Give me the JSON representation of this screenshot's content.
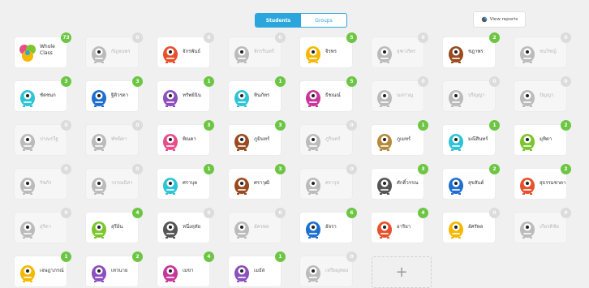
{
  "tabs": [
    {
      "label": "Students"
    },
    {
      "label": "Groups"
    }
  ],
  "view_reports_label": "View reports",
  "colors": {
    "accent": "#2aa6dd",
    "point_badge": "#6cc644",
    "zero_badge": "#dcdcdc"
  },
  "add_label": "+",
  "cards": [
    {
      "name": "Whole Class",
      "points": "73",
      "avatar": "class-icon",
      "color": "#e84c8a",
      "dim": false
    },
    {
      "name": "กัญจนพร",
      "points": "0",
      "avatar": "monster-avatar",
      "color": "#bbbbbb",
      "dim": true
    },
    {
      "name": "จักรพันธ์",
      "points": "0",
      "avatar": "monster-avatar",
      "color": "#e8502b",
      "dim": false
    },
    {
      "name": "จักรรินทร์",
      "points": "0",
      "avatar": "monster-avatar",
      "color": "#bbbbbb",
      "dim": true
    },
    {
      "name": "จิรพร",
      "points": "5",
      "avatar": "monster-avatar",
      "color": "#f5b800",
      "dim": false
    },
    {
      "name": "จุฑาภัทร",
      "points": "0",
      "avatar": "monster-avatar",
      "color": "#bbbbbb",
      "dim": true
    },
    {
      "name": "ชฎาพร",
      "points": "2",
      "avatar": "monster-avatar",
      "color": "#9a4a1e",
      "dim": false
    },
    {
      "name": "ชนวิชญ์",
      "points": "0",
      "avatar": "monster-avatar",
      "color": "#bbbbbb",
      "dim": true
    },
    {
      "name": "ชัดชนก",
      "points": "3",
      "avatar": "monster-avatar",
      "color": "#2ec3d6",
      "dim": false
    },
    {
      "name": "ฐิติวรดา",
      "points": "3",
      "avatar": "monster-avatar",
      "color": "#1e6fd0",
      "dim": false
    },
    {
      "name": "ทรัพย์นิน",
      "points": "1",
      "avatar": "monster-avatar",
      "color": "#8b4fc0",
      "dim": false
    },
    {
      "name": "ทินภัทร",
      "points": "1",
      "avatar": "monster-avatar",
      "color": "#2ec3d6",
      "dim": false
    },
    {
      "name": "ธิชณณ์",
      "points": "5",
      "avatar": "monster-avatar",
      "color": "#c7369a",
      "dim": false
    },
    {
      "name": "นภกาญ",
      "points": "0",
      "avatar": "monster-avatar",
      "color": "#bbbbbb",
      "dim": true
    },
    {
      "name": "ปริญญา",
      "points": "0",
      "avatar": "monster-avatar",
      "color": "#bbbbbb",
      "dim": true
    },
    {
      "name": "ปัญญา",
      "points": "0",
      "avatar": "monster-avatar",
      "color": "#bbbbbb",
      "dim": true
    },
    {
      "name": "ปาณรวีฐ",
      "points": "0",
      "avatar": "monster-avatar",
      "color": "#bbbbbb",
      "dim": true
    },
    {
      "name": "พัชนิดา",
      "points": "0",
      "avatar": "monster-avatar",
      "color": "#bbbbbb",
      "dim": true
    },
    {
      "name": "พิณดา",
      "points": "3",
      "avatar": "monster-avatar",
      "color": "#e84c8a",
      "dim": false
    },
    {
      "name": "ภูมินทร์",
      "points": "3",
      "avatar": "monster-avatar",
      "color": "#9a4a1e",
      "dim": false
    },
    {
      "name": "ภูรินทร์",
      "points": "0",
      "avatar": "monster-avatar",
      "color": "#bbbbbb",
      "dim": true
    },
    {
      "name": "ภูเมทร์",
      "points": "1",
      "avatar": "monster-avatar",
      "color": "#b58a3c",
      "dim": false
    },
    {
      "name": "มณีสินทร์",
      "points": "1",
      "avatar": "monster-avatar",
      "color": "#2ec3d6",
      "dim": false
    },
    {
      "name": "มุทิตา",
      "points": "2",
      "avatar": "monster-avatar",
      "color": "#7bc62d",
      "dim": false
    },
    {
      "name": "รัชภัร",
      "points": "0",
      "avatar": "monster-avatar",
      "color": "#bbbbbb",
      "dim": true
    },
    {
      "name": "วรรณนิสา",
      "points": "0",
      "avatar": "monster-avatar",
      "color": "#bbbbbb",
      "dim": true
    },
    {
      "name": "ศราบุต",
      "points": "1",
      "avatar": "monster-avatar",
      "color": "#2ec3d6",
      "dim": false
    },
    {
      "name": "ศราวุฒิ",
      "points": "3",
      "avatar": "monster-avatar",
      "color": "#9a4a1e",
      "dim": false
    },
    {
      "name": "ศรารุส",
      "points": "0",
      "avatar": "monster-avatar",
      "color": "#bbbbbb",
      "dim": true
    },
    {
      "name": "ศักดิ์วรรณ",
      "points": "3",
      "avatar": "monster-avatar",
      "color": "#555555",
      "dim": false
    },
    {
      "name": "สุขสันต์",
      "points": "2",
      "avatar": "monster-avatar",
      "color": "#1e6fd0",
      "dim": false
    },
    {
      "name": "สุธรรมชาดา",
      "points": "2",
      "avatar": "monster-avatar",
      "color": "#e8502b",
      "dim": false
    },
    {
      "name": "สุริดา",
      "points": "0",
      "avatar": "monster-avatar",
      "color": "#bbbbbb",
      "dim": true
    },
    {
      "name": "สุรีย์น",
      "points": "4",
      "avatar": "monster-avatar",
      "color": "#7bc62d",
      "dim": false
    },
    {
      "name": "หนึ่งฤทัย",
      "points": "0",
      "avatar": "monster-avatar",
      "color": "#555555",
      "dim": false
    },
    {
      "name": "อัครพล",
      "points": "0",
      "avatar": "monster-avatar",
      "color": "#bbbbbb",
      "dim": true
    },
    {
      "name": "อัจรา",
      "points": "6",
      "avatar": "monster-avatar",
      "color": "#1e6fd0",
      "dim": false
    },
    {
      "name": "อาริยา",
      "points": "4",
      "avatar": "monster-avatar",
      "color": "#e8502b",
      "dim": false
    },
    {
      "name": "อัศรัพล",
      "points": "0",
      "avatar": "monster-avatar",
      "color": "#f5b800",
      "dim": false
    },
    {
      "name": "เกียรติชัย",
      "points": "0",
      "avatar": "monster-avatar",
      "color": "#bbbbbb",
      "dim": true
    },
    {
      "name": "เจษฎาภรณ์",
      "points": "1",
      "avatar": "monster-avatar",
      "color": "#f5b800",
      "dim": false
    },
    {
      "name": "เทวนาย",
      "points": "2",
      "avatar": "monster-avatar",
      "color": "#8b4fc0",
      "dim": false
    },
    {
      "name": "เมขา",
      "points": "4",
      "avatar": "monster-avatar",
      "color": "#c7369a",
      "dim": false
    },
    {
      "name": "เมธัส",
      "points": "1",
      "avatar": "monster-avatar",
      "color": "#8b4fc0",
      "dim": false
    },
    {
      "name": "เหรียญทอง",
      "points": "0",
      "avatar": "monster-avatar",
      "color": "#bbbbbb",
      "dim": true
    }
  ]
}
